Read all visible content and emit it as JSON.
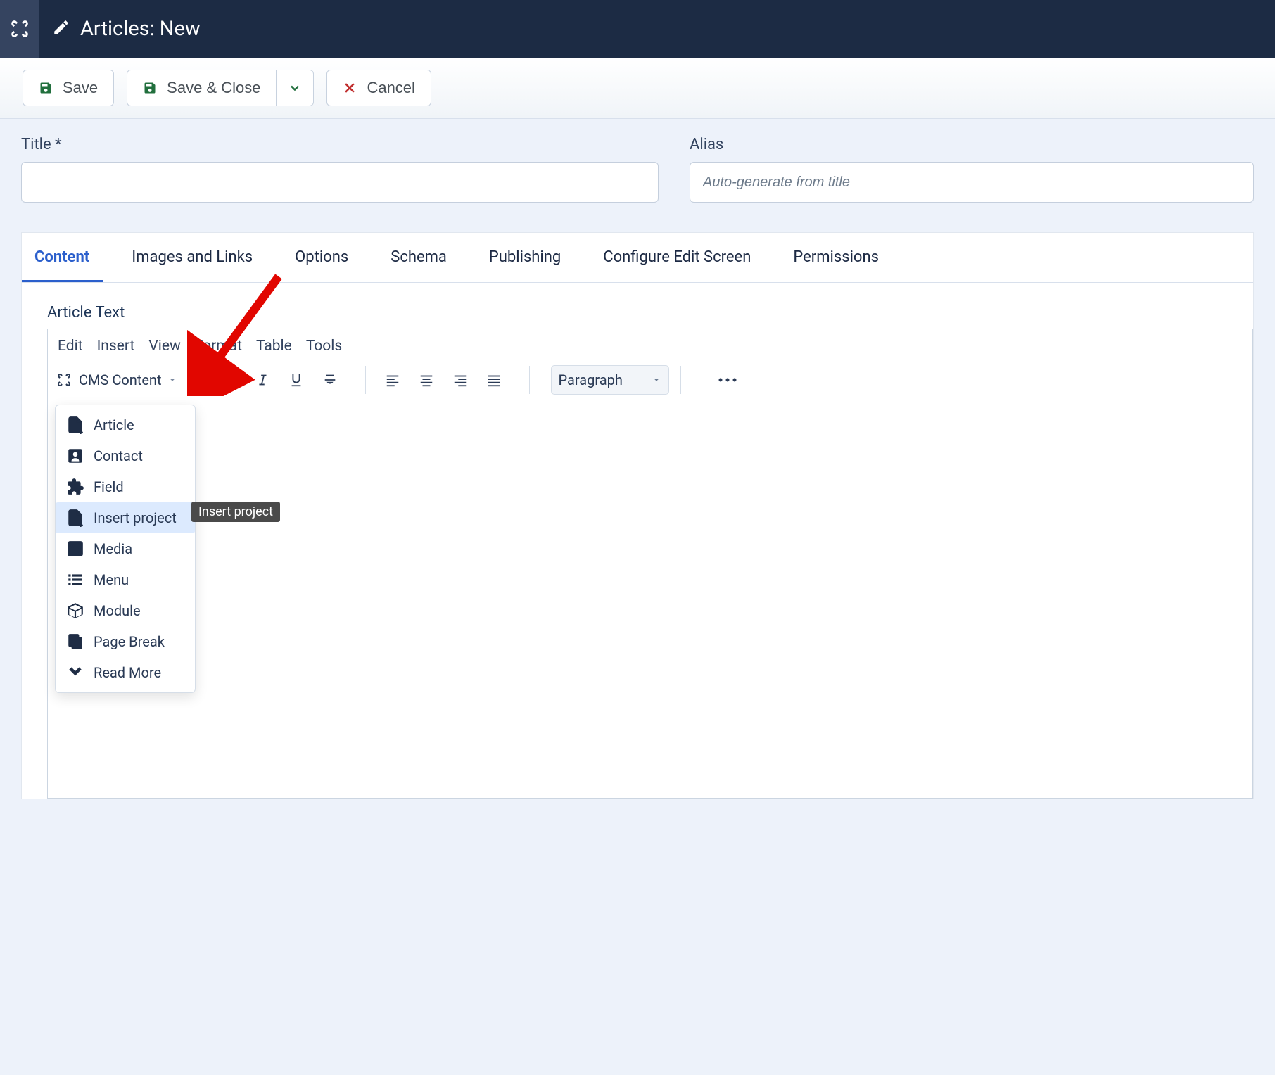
{
  "header": {
    "title": "Articles: New"
  },
  "toolbar": {
    "save": "Save",
    "save_close": "Save & Close",
    "cancel": "Cancel"
  },
  "fields": {
    "title_label": "Title *",
    "alias_label": "Alias",
    "alias_placeholder": "Auto-generate from title"
  },
  "tabs": [
    "Content",
    "Images and Links",
    "Options",
    "Schema",
    "Publishing",
    "Configure Edit Screen",
    "Permissions"
  ],
  "editor": {
    "label": "Article Text",
    "menu": [
      "Edit",
      "Insert",
      "View",
      "Format",
      "Table",
      "Tools"
    ],
    "cms_content_label": "CMS Content",
    "paragraph_label": "Paragraph",
    "dropdown_items": [
      "Article",
      "Contact",
      "Field",
      "Insert project",
      "Media",
      "Menu",
      "Module",
      "Page Break",
      "Read More"
    ],
    "highlight_index": 3,
    "tooltip": "Insert project"
  }
}
